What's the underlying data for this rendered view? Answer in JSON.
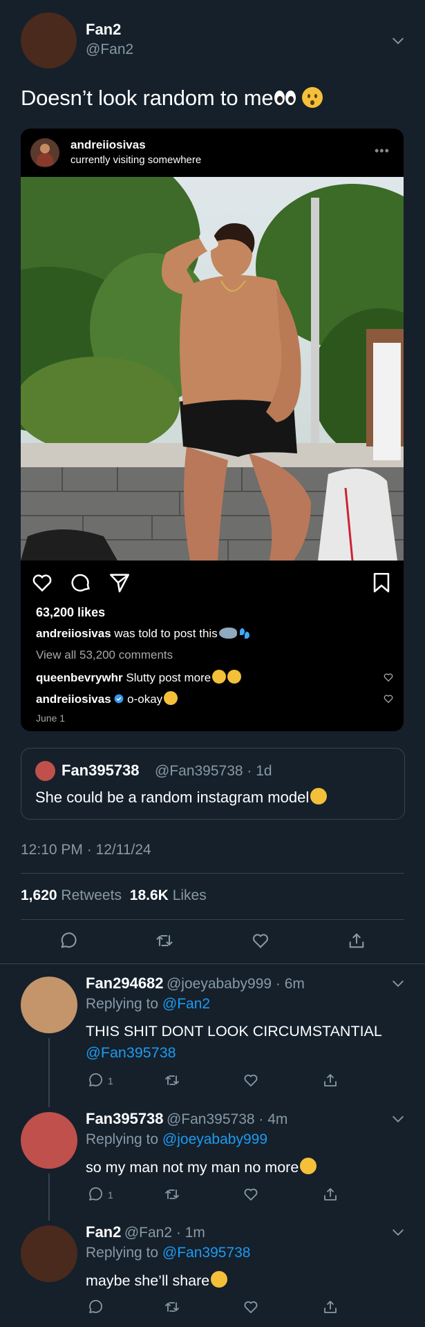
{
  "tweet": {
    "display_name": "Fan2",
    "handle": "@Fan2",
    "text": "Doesn’t look random to me",
    "timestamp": "12:10 PM · 12/11/24",
    "retweets_count": "1,620",
    "retweets_label": "Retweets",
    "likes_count": "18.6K",
    "likes_label": "Likes"
  },
  "instagram_post": {
    "username": "andreiiosivas",
    "location": "currently visiting somewhere",
    "likes": "63,200 likes",
    "caption_user": "andreiiosivas",
    "caption_text": "was told to post this",
    "view_comments": "View all 53,200 comments",
    "comments": [
      {
        "user": "queenbevrywhr",
        "text": "Slutty post more"
      },
      {
        "user": "andreiiosivas",
        "text": "o-okay"
      }
    ],
    "date": "June 1"
  },
  "quoted_tweet": {
    "display_name": "Fan395738",
    "meta": "@Fan395738 · 1d",
    "text": "She could be a random instagram model"
  },
  "replies": [
    {
      "display_name": "Fan294682",
      "meta": "@joeyababy999 · 6m",
      "replying_label": "Replying to",
      "replying_to": "@Fan2",
      "text_line1": "THIS SHIT DONT LOOK CIRCUMSTANTIAL",
      "text_mention": "@Fan395738",
      "reply_count": "1",
      "avatar_color": "#c4956a"
    },
    {
      "display_name": "Fan395738",
      "meta": "@Fan395738 · 4m",
      "replying_label": "Replying to",
      "replying_to": "@joeyababy999",
      "text_line1": "so my man not my man no more",
      "reply_count": "1",
      "avatar_color": "#c0504b"
    },
    {
      "display_name": "Fan2",
      "meta": "@Fan2 · 1m",
      "replying_label": "Replying to",
      "replying_to": "@Fan395738",
      "text_line1": "maybe she’ll share",
      "avatar_color": "#4a2a1c"
    }
  ],
  "colors": {
    "background": "#15202b",
    "accent": "#1d9bf0",
    "muted": "#8899a6",
    "divider": "#38444d"
  }
}
